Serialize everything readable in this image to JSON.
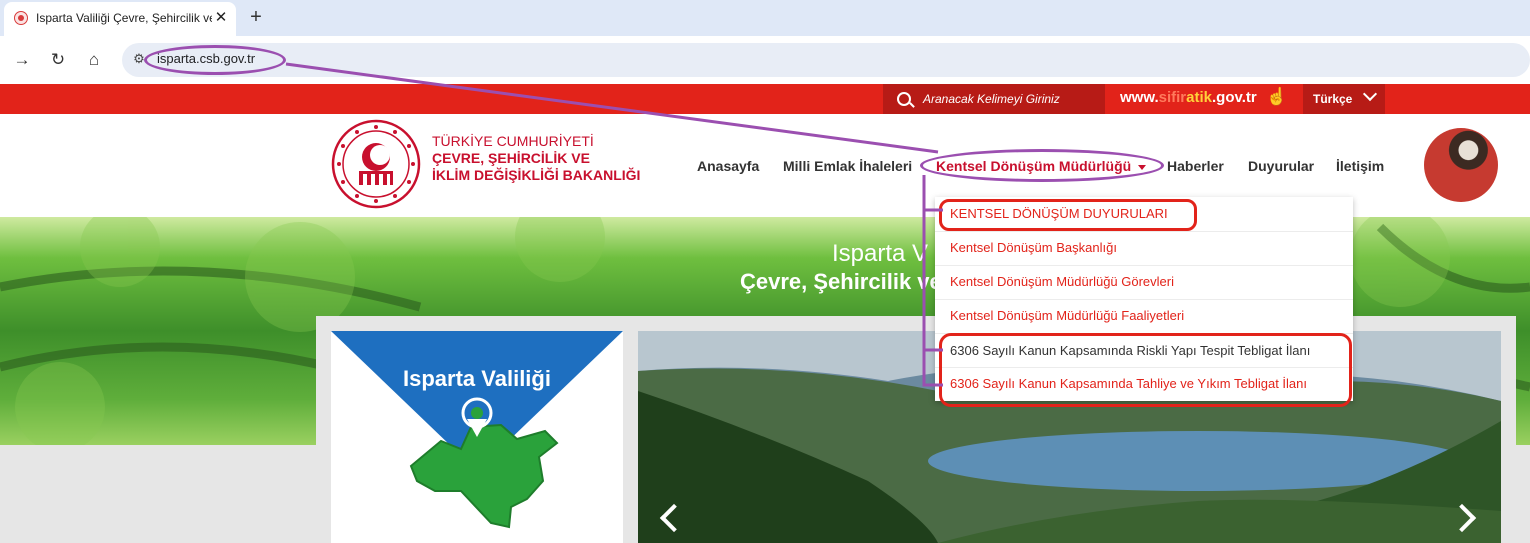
{
  "browser": {
    "tab_title": "Isparta Valiliği Çevre, Şehircilik ve İklim Değişikliği",
    "close_symbol": "✕",
    "new_tab_symbol": "+",
    "url": "isparta.csb.gov.tr"
  },
  "topbar": {
    "search_placeholder": "Aranacak Kelimeyi Giriniz",
    "site_link": {
      "prefix": "www.",
      "part1": "sifir",
      "part2": "atik",
      "suffix": ".gov.tr"
    },
    "language": "Türkçe"
  },
  "ministry": {
    "line1": "TÜRKİYE CUMHURİYETİ",
    "line2": "ÇEVRE, ŞEHİRCİLİK VE",
    "line3": "İKLİM DEĞİŞİKLİĞİ BAKANLIĞI"
  },
  "nav": {
    "home": "Anasayfa",
    "tenders": "Milli Emlak İhaleleri",
    "urban": "Kentsel Dönüşüm Müdürlüğü",
    "news": "Haberler",
    "announcements": "Duyurular",
    "contact": "İletişim"
  },
  "dropdown": {
    "items": [
      "KENTSEL DÖNÜŞÜM DUYURULARI",
      "Kentsel Dönüşüm Başkanlığı",
      "Kentsel Dönüşüm Müdürlüğü Görevleri",
      "Kentsel Dönüşüm Müdürlüğü Faaliyetleri",
      "6306 Sayılı Kanun Kapsamında Riskli Yapı Tespit Tebligat İlanı",
      "6306 Sayılı Kanun Kapsamında Tahliye ve Yıkım Tebligat İlanı"
    ]
  },
  "hero": {
    "title_line1": "Isparta V",
    "title_line2": "Çevre, Şehircilik ve İklim D"
  },
  "valilik_card": {
    "title": "Isparta Valiliği"
  },
  "colors": {
    "brand_red": "#e2231a",
    "ministry_red": "#c8102e",
    "annotation_purple": "#9b4fb0"
  }
}
